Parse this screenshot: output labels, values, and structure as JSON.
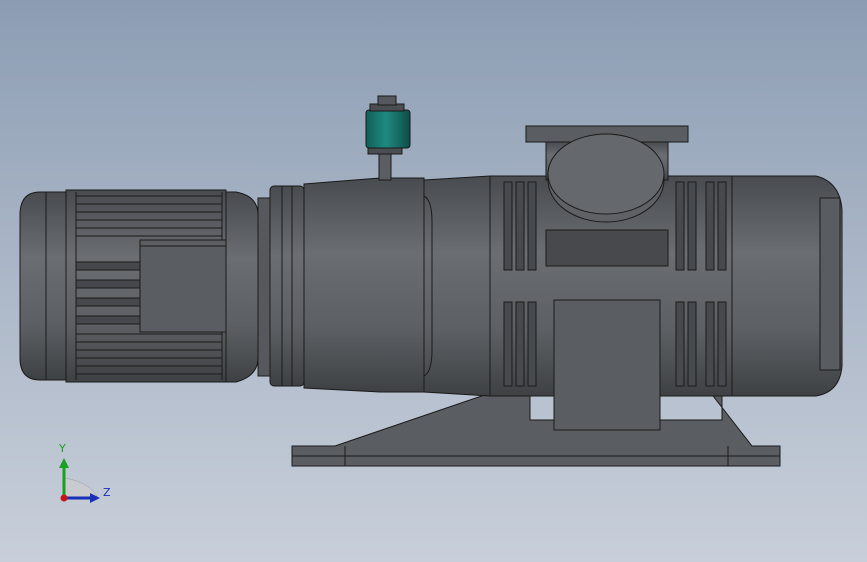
{
  "viewport": {
    "background_top": "#8c9db3",
    "background_bottom": "#c8cfda"
  },
  "model": {
    "body_color": "#5e6266",
    "edge_color": "#1a1a1a",
    "valve_color": "#1f8a80"
  },
  "triad": {
    "y_label": "Y",
    "z_label": "Z",
    "y_color": "#19a01e",
    "z_color": "#1a2fb8",
    "x_color": "#c81414"
  }
}
